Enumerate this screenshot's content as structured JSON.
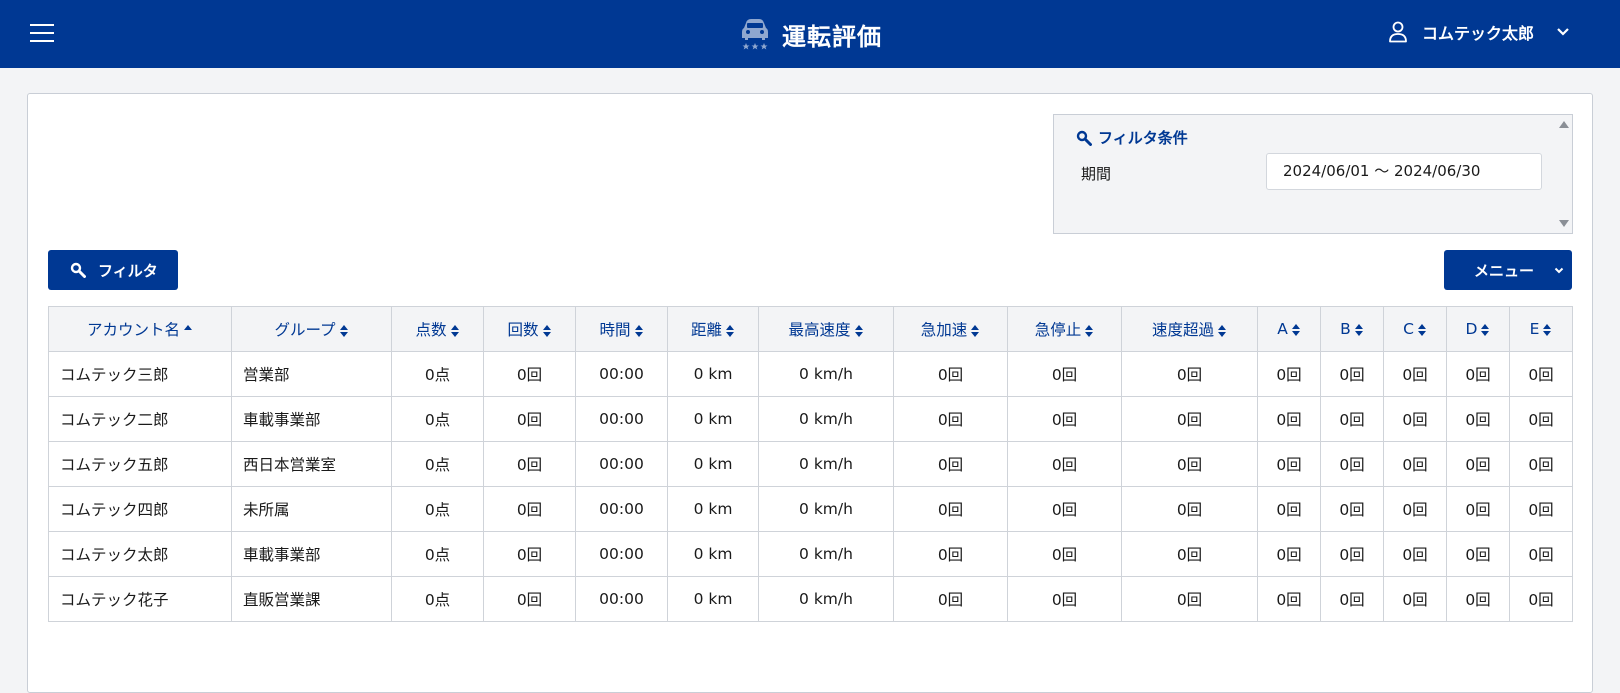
{
  "header": {
    "title": "運転評価",
    "app_icon": "car-rating-icon",
    "user_name": "コムテック太郎",
    "user_icon": "user-icon",
    "colors": {
      "bar": "#003893",
      "text": "#ffffff"
    }
  },
  "filter": {
    "title": "フィルタ条件",
    "period_label": "期間",
    "period_value": "2024/06/01 〜 2024/06/30"
  },
  "buttons": {
    "filter_label": "フィルタ",
    "menu_label": "メニュー"
  },
  "table": {
    "sorted_column": "アカウント名",
    "sort_direction": "ascending",
    "columns": [
      {
        "label": "アカウント名"
      },
      {
        "label": "グループ"
      },
      {
        "label": "点数"
      },
      {
        "label": "回数"
      },
      {
        "label": "時間"
      },
      {
        "label": "距離"
      },
      {
        "label": "最高速度"
      },
      {
        "label": "急加速"
      },
      {
        "label": "急停止"
      },
      {
        "label": "速度超過"
      },
      {
        "label": "A"
      },
      {
        "label": "B"
      },
      {
        "label": "C"
      },
      {
        "label": "D"
      },
      {
        "label": "E"
      }
    ],
    "rows": [
      [
        "コムテック三郎",
        "営業部",
        "0点",
        "0回",
        "00:00",
        "0 km",
        "0 km/h",
        "0回",
        "0回",
        "0回",
        "0回",
        "0回",
        "0回",
        "0回",
        "0回"
      ],
      [
        "コムテック二郎",
        "車載事業部",
        "0点",
        "0回",
        "00:00",
        "0 km",
        "0 km/h",
        "0回",
        "0回",
        "0回",
        "0回",
        "0回",
        "0回",
        "0回",
        "0回"
      ],
      [
        "コムテック五郎",
        "西日本営業室",
        "0点",
        "0回",
        "00:00",
        "0 km",
        "0 km/h",
        "0回",
        "0回",
        "0回",
        "0回",
        "0回",
        "0回",
        "0回",
        "0回"
      ],
      [
        "コムテック四郎",
        "未所属",
        "0点",
        "0回",
        "00:00",
        "0 km",
        "0 km/h",
        "0回",
        "0回",
        "0回",
        "0回",
        "0回",
        "0回",
        "0回",
        "0回"
      ],
      [
        "コムテック太郎",
        "車載事業部",
        "0点",
        "0回",
        "00:00",
        "0 km",
        "0 km/h",
        "0回",
        "0回",
        "0回",
        "0回",
        "0回",
        "0回",
        "0回",
        "0回"
      ],
      [
        "コムテック花子",
        "直販営業課",
        "0点",
        "0回",
        "00:00",
        "0 km",
        "0 km/h",
        "0回",
        "0回",
        "0回",
        "0回",
        "0回",
        "0回",
        "0回",
        "0回"
      ]
    ]
  }
}
